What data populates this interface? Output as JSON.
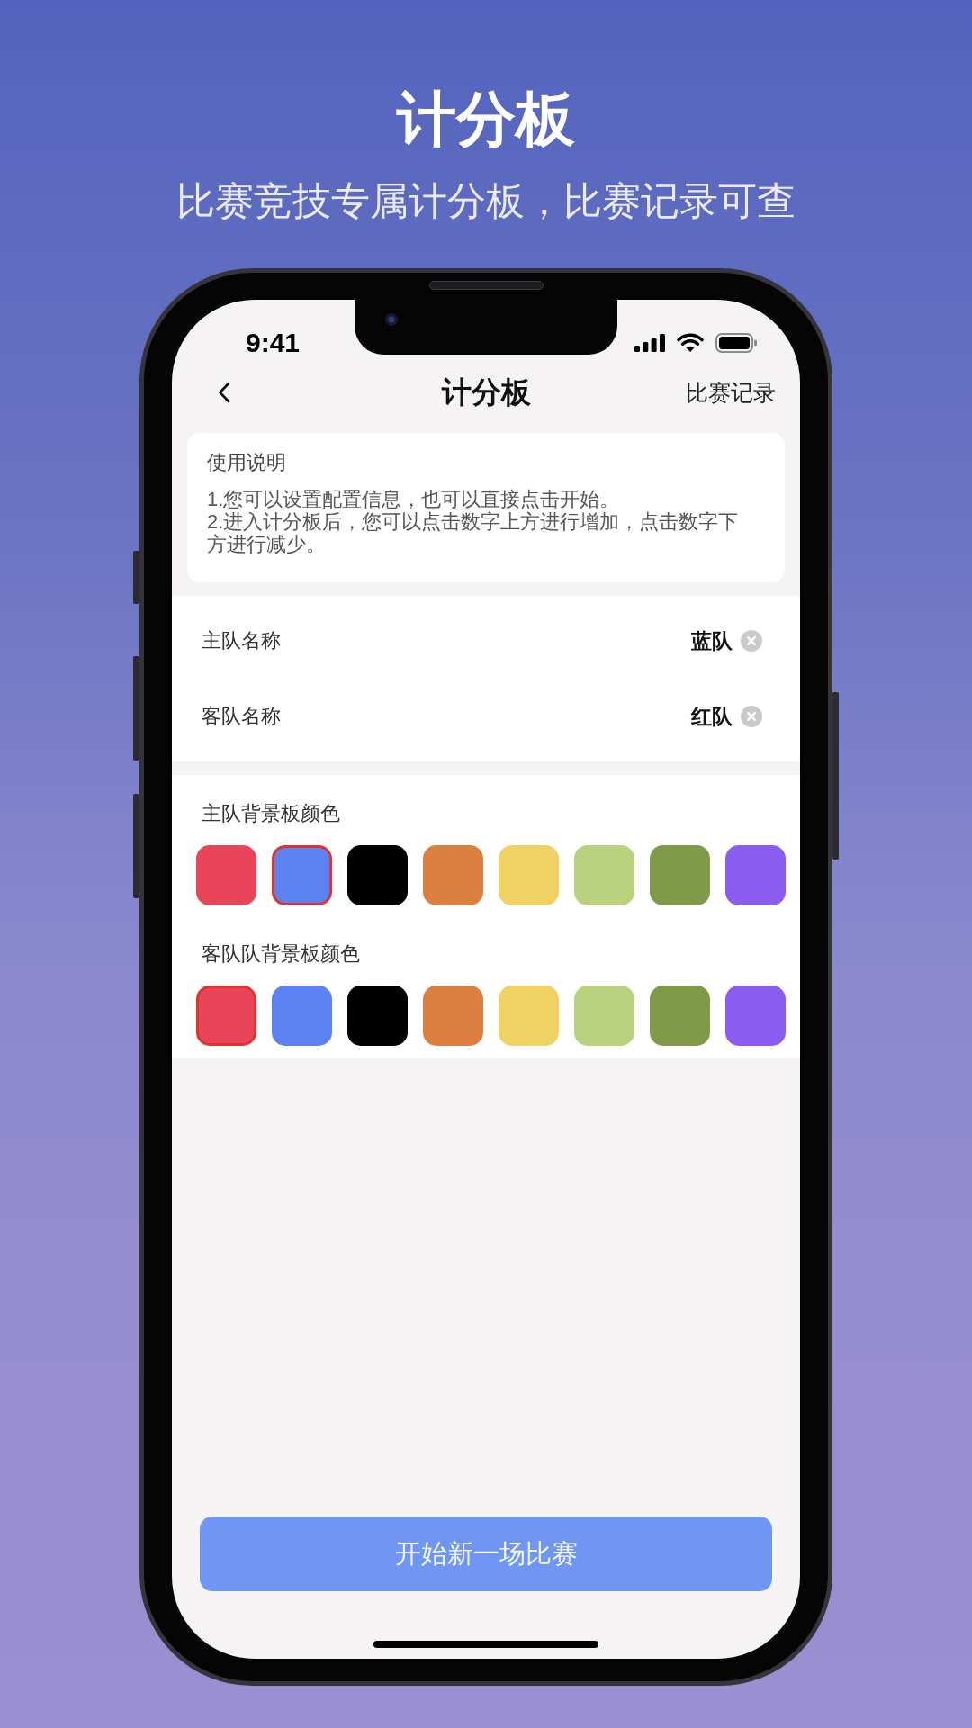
{
  "promo": {
    "title": "计分板",
    "subtitle": "比赛竞技专属计分板，比赛记录可查"
  },
  "status_bar": {
    "time": "9:41"
  },
  "nav_bar": {
    "title": "计分板",
    "action": "比赛记录"
  },
  "instructions": {
    "title": "使用说明",
    "lines": [
      "1.您可以设置配置信息，也可以直接点击开始。",
      "2.进入计分板后，您可以点击数字上方进行增加，点击数字下方进行减少。"
    ]
  },
  "team_names": [
    {
      "label": "主队名称",
      "value": "蓝队"
    },
    {
      "label": "客队名称",
      "value": "红队"
    }
  ],
  "color_pickers": [
    {
      "label": "主队背景板颜色",
      "swatches": [
        {
          "color": "#e8445a",
          "selected": false
        },
        {
          "color": "#5b82f0",
          "selected": true
        },
        {
          "color": "#000000",
          "selected": false
        },
        {
          "color": "#db8040",
          "selected": false
        },
        {
          "color": "#f0d264",
          "selected": false
        },
        {
          "color": "#b8d27e",
          "selected": false
        },
        {
          "color": "#7f9a48",
          "selected": false
        },
        {
          "color": "#8a5cf0",
          "selected": false
        }
      ]
    },
    {
      "label": "客队队背景板颜色",
      "swatches": [
        {
          "color": "#e8445a",
          "selected": true
        },
        {
          "color": "#5b82f0",
          "selected": false
        },
        {
          "color": "#000000",
          "selected": false
        },
        {
          "color": "#db8040",
          "selected": false
        },
        {
          "color": "#f0d264",
          "selected": false
        },
        {
          "color": "#b8d27e",
          "selected": false
        },
        {
          "color": "#7f9a48",
          "selected": false
        },
        {
          "color": "#8a5cf0",
          "selected": false
        }
      ]
    }
  ],
  "start_button": {
    "label": "开始新一场比赛"
  }
}
